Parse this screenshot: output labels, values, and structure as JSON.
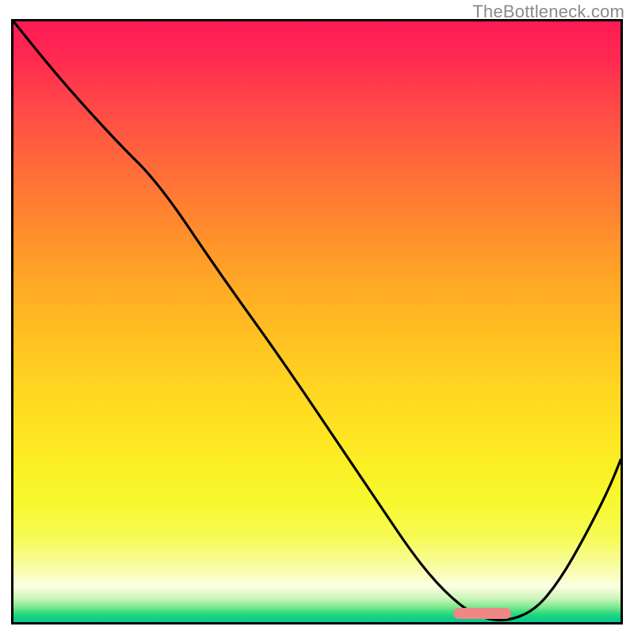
{
  "attribution": "TheBottleneck.com",
  "colors": {
    "gradient_top": "#ff1a55",
    "gradient_mid": "#ffd322",
    "gradient_bottom": "#08c89c",
    "curve": "#000000",
    "marker": "#ef8784",
    "border": "#000000"
  },
  "chart_data": {
    "type": "line",
    "title": "",
    "xlabel": "",
    "ylabel": "",
    "xlim": [
      0,
      1
    ],
    "ylim": [
      0,
      1
    ],
    "series": [
      {
        "name": "bottleneck-curve",
        "x": [
          0.0,
          0.08,
          0.17,
          0.24,
          0.34,
          0.44,
          0.54,
          0.6,
          0.66,
          0.71,
          0.76,
          0.81,
          0.86,
          0.9,
          0.94,
          0.98,
          1.0
        ],
        "y": [
          1.0,
          0.9,
          0.8,
          0.73,
          0.58,
          0.44,
          0.29,
          0.2,
          0.11,
          0.05,
          0.01,
          0.0,
          0.02,
          0.07,
          0.14,
          0.22,
          0.27
        ]
      }
    ],
    "annotations": [
      {
        "name": "optimal-range",
        "type": "marker-pill",
        "x_start": 0.725,
        "x_end": 0.82,
        "y": 0.005
      }
    ],
    "background": {
      "type": "vertical-heat-gradient",
      "meaning": "red=high bottleneck, green=no bottleneck",
      "stops": [
        {
          "pos": 0.0,
          "color": "#ff1a55"
        },
        {
          "pos": 0.5,
          "color": "#ffd322"
        },
        {
          "pos": 0.9,
          "color": "#f7f82f"
        },
        {
          "pos": 1.0,
          "color": "#08c89c"
        }
      ]
    }
  }
}
